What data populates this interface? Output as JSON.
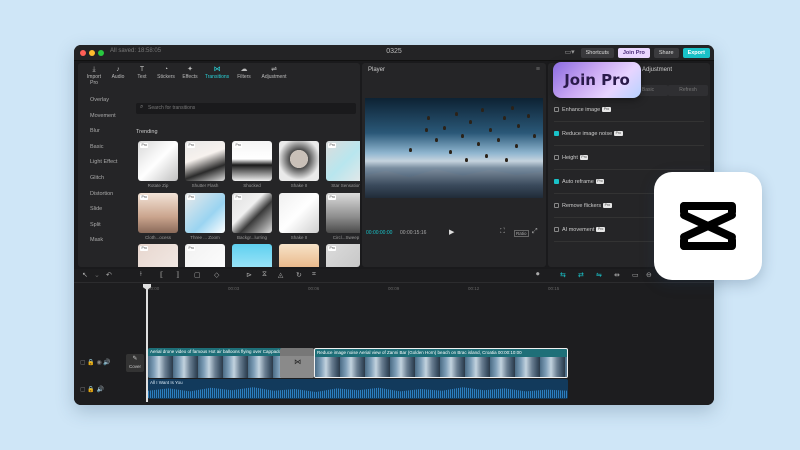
{
  "titlebar": {
    "status": "All saved: 18:58:05",
    "project": "0325",
    "shortcuts": "Shortcuts",
    "join_pro": "Join Pro",
    "share": "Share",
    "export": "Export"
  },
  "top_tabs": [
    {
      "label": "Import",
      "icon": "import-icon"
    },
    {
      "label": "Audio",
      "icon": "audio-icon"
    },
    {
      "label": "Text",
      "icon": "text-icon"
    },
    {
      "label": "Stickers",
      "icon": "stickers-icon"
    },
    {
      "label": "Effects",
      "icon": "effects-icon"
    },
    {
      "label": "Transitions",
      "icon": "transitions-icon",
      "active": true
    },
    {
      "label": "Filters",
      "icon": "filters-icon"
    },
    {
      "label": "Adjustment",
      "icon": "adjustment-icon"
    }
  ],
  "side_label_pro": "Pro",
  "categories": [
    "Overlay",
    "Movement",
    "Blur",
    "Basic",
    "Light Effect",
    "Glitch",
    "Distortion",
    "Slide",
    "Split",
    "Mask"
  ],
  "search_placeholder": "Search for transitions",
  "trending_label": "Trending",
  "thumbs": [
    {
      "caption": "Rotate Zip",
      "pro": "Pro"
    },
    {
      "caption": "Shutter Flash",
      "pro": "Pro"
    },
    {
      "caption": "Shocked",
      "pro": "Pro"
    },
    {
      "caption": "Shake II",
      "pro": ""
    },
    {
      "caption": "Star Sensation",
      "pro": "Pro"
    },
    {
      "caption": "Cloth...ocess",
      "pro": "Pro"
    },
    {
      "caption": "Three ... Zoom",
      "pro": "Pro"
    },
    {
      "caption": "Backgr...lurring",
      "pro": "Pro"
    },
    {
      "caption": "Shake II",
      "pro": ""
    },
    {
      "caption": "Circl...Sweep",
      "pro": "Pro"
    },
    {
      "caption": "",
      "pro": "Pro"
    },
    {
      "caption": "",
      "pro": "Pro"
    },
    {
      "caption": "",
      "pro": ""
    },
    {
      "caption": "",
      "pro": ""
    },
    {
      "caption": "",
      "pro": "Pro"
    }
  ],
  "player": {
    "title": "Player",
    "time_current": "00:00:00:00",
    "time_total": "00:00:15:16",
    "ratio": "Ratio"
  },
  "inspector": {
    "tab_adjustment": "Adjustment",
    "sub_a": "Basic",
    "sub_b": "Refresh",
    "options": [
      {
        "label": "Enhance image",
        "checked": false,
        "pro": "Pro"
      },
      {
        "label": "Reduce image noise",
        "checked": true,
        "pro": "Pro"
      },
      {
        "label": "Height",
        "checked": false,
        "pro": "Pro"
      },
      {
        "label": "Auto reframe",
        "checked": true,
        "pro": "Pro"
      },
      {
        "label": "Remove flickers",
        "checked": false,
        "pro": "Pro"
      },
      {
        "label": "AI movement",
        "checked": false,
        "pro": "Pro"
      }
    ]
  },
  "timeline": {
    "ticks": [
      "00:00",
      "00:03",
      "00:06",
      "00:09",
      "00:12",
      "00:15"
    ],
    "cover": "Cover",
    "clip1": "Aerial drone video of famous Hot air balloons flying over Cappado",
    "clip2": "Reduce image noise   Aerial view of Zanni Bar (Golden Horn) beach on Brac island, Croatia  00:00:10:00",
    "audio": "All I Want Is You"
  },
  "badge": {
    "label": "Join Pro"
  },
  "colors": {
    "accent": "#19c2c8",
    "background": "#cfe6f7",
    "window": "#1a1a1c",
    "panel": "#252527"
  }
}
